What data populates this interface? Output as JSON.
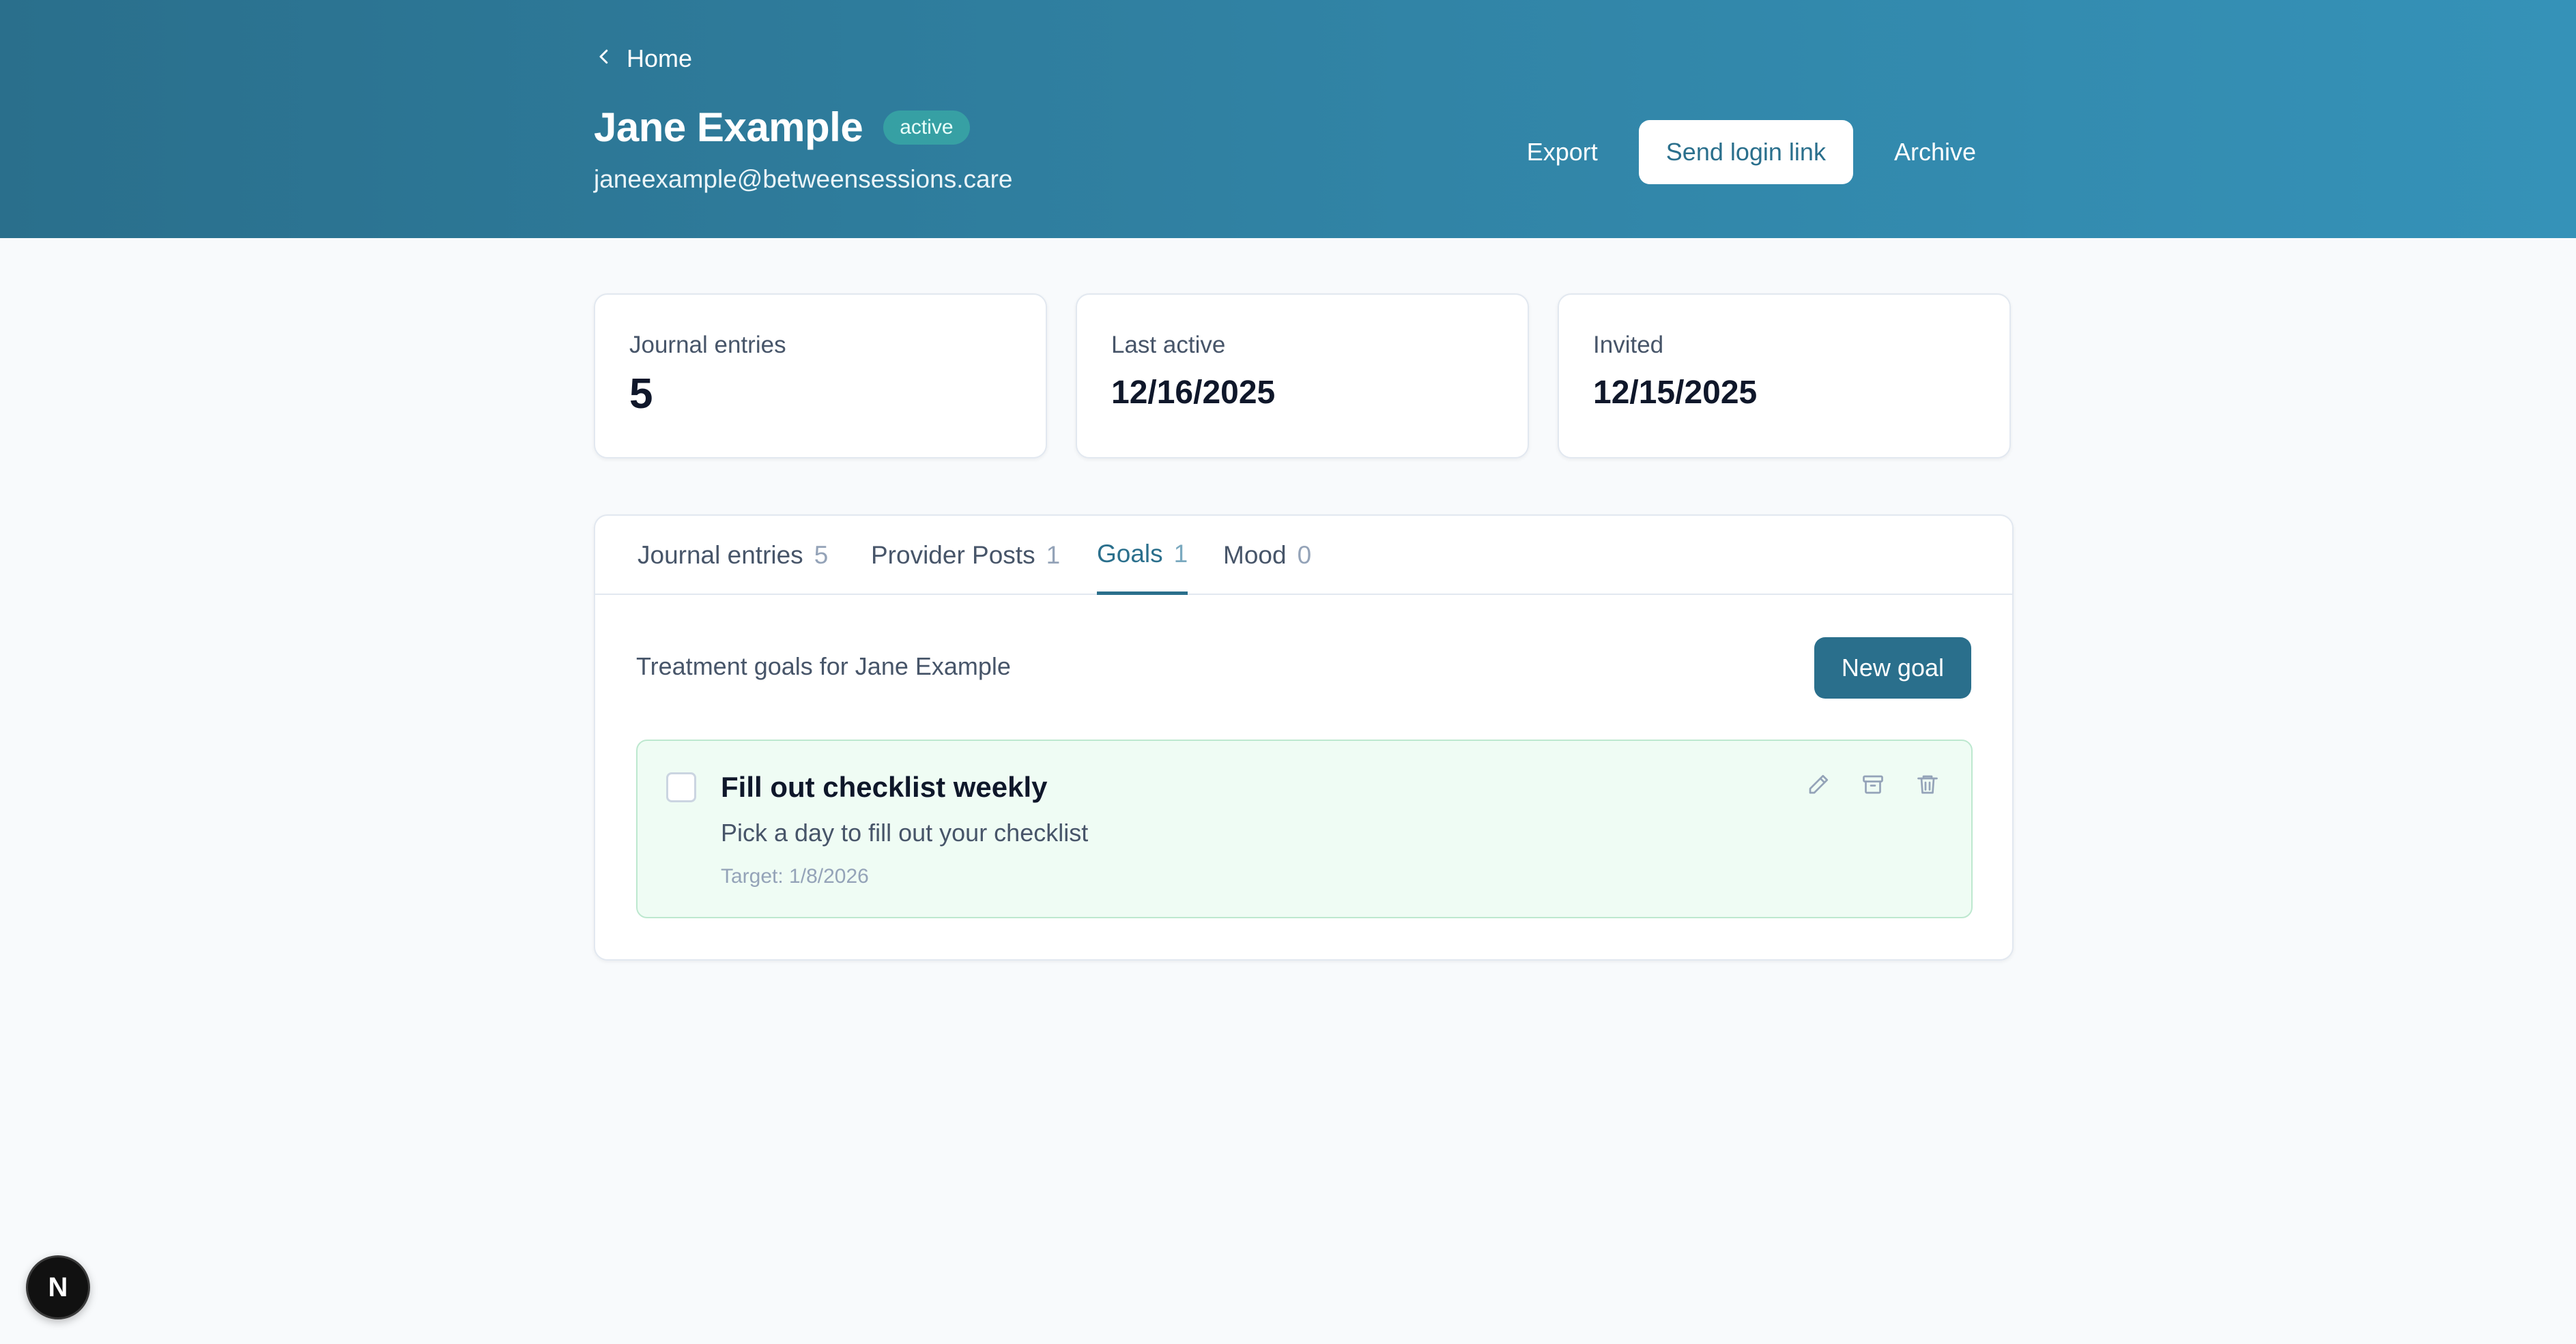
{
  "header": {
    "back_label": "Home",
    "title": "Jane Example",
    "status_badge": "active",
    "email": "janeexample@betweensessions.care",
    "actions": {
      "export": "Export",
      "send_login_link": "Send login link",
      "archive": "Archive"
    }
  },
  "stats": [
    {
      "label": "Journal entries",
      "value": "5"
    },
    {
      "label": "Last active",
      "value": "12/16/2025"
    },
    {
      "label": "Invited",
      "value": "12/15/2025"
    }
  ],
  "tabs": [
    {
      "label": "Journal entries",
      "count": "5"
    },
    {
      "label": "Provider Posts",
      "count": "1"
    },
    {
      "label": "Goals",
      "count": "1",
      "active": true
    },
    {
      "label": "Mood",
      "count": "0"
    }
  ],
  "goals_panel": {
    "subtitle": "Treatment goals for Jane Example",
    "new_goal": "New goal",
    "goals": [
      {
        "title": "Fill out checklist weekly",
        "description": "Pick a day to fill out your checklist",
        "target": "Target: 1/8/2026",
        "completed": false
      }
    ]
  },
  "dev_badge": "N",
  "colors": {
    "header_start": "#2a6f8c",
    "header_end": "#3592b8",
    "accent": "#2a6f8c",
    "goal_bg": "#effcf4"
  },
  "icons": [
    "chevron-left-icon",
    "pencil-icon",
    "archive-icon",
    "trash-icon"
  ]
}
